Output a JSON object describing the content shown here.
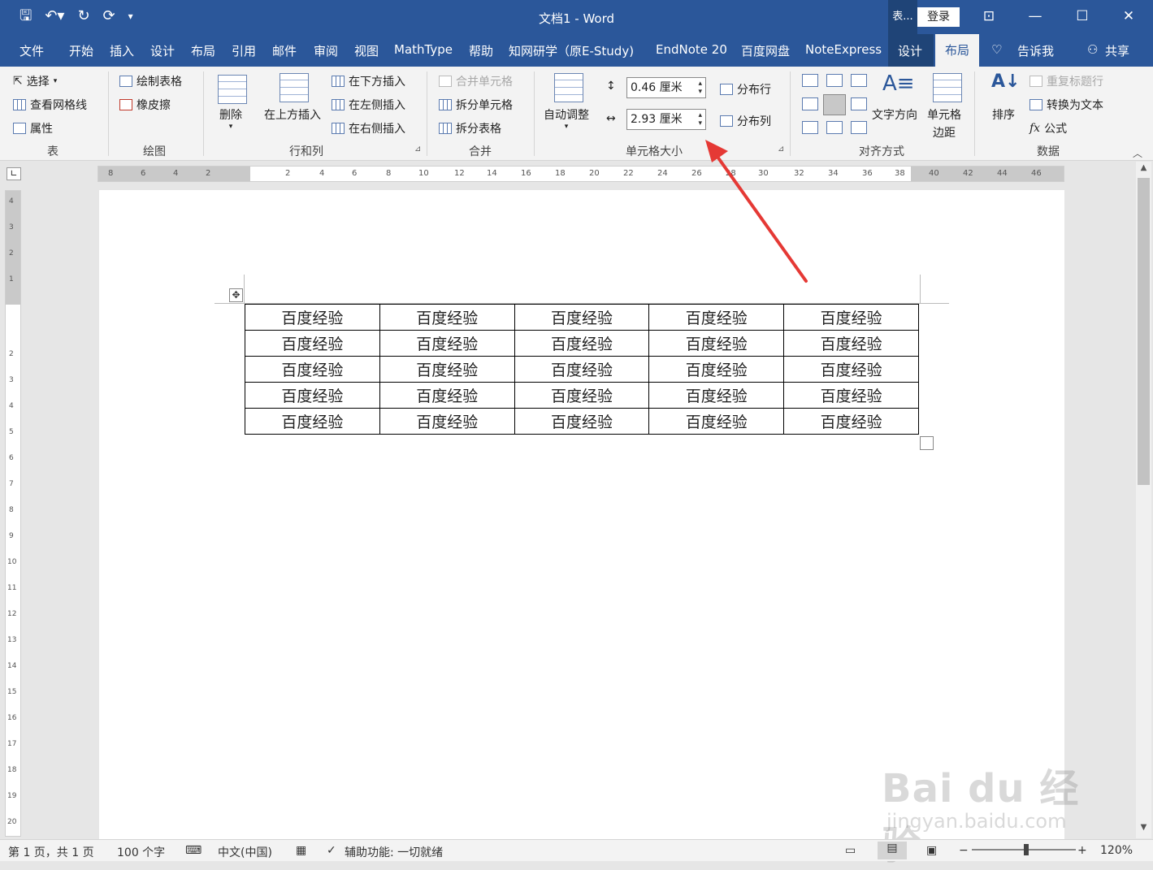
{
  "titlebar": {
    "doc_title": "文档1  -  Word",
    "context_label": "表...",
    "login": "登录"
  },
  "tabs": [
    "文件",
    "开始",
    "插入",
    "设计",
    "布局",
    "引用",
    "邮件",
    "审阅",
    "视图",
    "MathType",
    "帮助",
    "知网研学（原E-Study)",
    "EndNote 20",
    "百度网盘",
    "NoteExpress",
    "设计"
  ],
  "active_tab": "布局",
  "tell_me": "告诉我",
  "share": "共享",
  "ribbon": {
    "group_table": {
      "select": "选择",
      "gridlines": "查看网格线",
      "properties": "属性",
      "label": "表"
    },
    "group_draw": {
      "draw_table": "绘制表格",
      "eraser": "橡皮擦",
      "label": "绘图"
    },
    "group_rows": {
      "delete": "删除",
      "insert_above": "在上方插入",
      "insert_below": "在下方插入",
      "insert_left": "在左侧插入",
      "insert_right": "在右侧插入",
      "label": "行和列"
    },
    "group_merge": {
      "merge_cells": "合并单元格",
      "split_cells": "拆分单元格",
      "split_table": "拆分表格",
      "label": "合并"
    },
    "group_size": {
      "autofit": "自动调整",
      "height": "0.46 厘米",
      "width": "2.93 厘米",
      "distribute_rows": "分布行",
      "distribute_cols": "分布列",
      "label": "单元格大小"
    },
    "group_align": {
      "text_direction": "文字方向",
      "cell_margins_1": "单元格",
      "cell_margins_2": "边距",
      "label": "对齐方式"
    },
    "group_data": {
      "sort": "排序",
      "repeat_header": "重复标题行",
      "convert_text": "转换为文本",
      "formula": "公式",
      "label": "数据"
    }
  },
  "table": {
    "rows": [
      [
        "百度经验",
        "百度经验",
        "百度经验",
        "百度经验",
        "百度经验"
      ],
      [
        "百度经验",
        "百度经验",
        "百度经验",
        "百度经验",
        "百度经验"
      ],
      [
        "百度经验",
        "百度经验",
        "百度经验",
        "百度经验",
        "百度经验"
      ],
      [
        "百度经验",
        "百度经验",
        "百度经验",
        "百度经验",
        "百度经验"
      ],
      [
        "百度经验",
        "百度经验",
        "百度经验",
        "百度经验",
        "百度经验"
      ]
    ]
  },
  "statusbar": {
    "page": "第 1 页，共 1 页",
    "words": "100 个字",
    "language": "中文(中国)",
    "accessibility": "辅助功能: 一切就绪",
    "zoom": "120%"
  },
  "watermark": {
    "line1": "Bai du 经验",
    "line2": "jingyan.baidu.com"
  },
  "colors": {
    "accent": "#2b579a",
    "context_tab": "#1f4477",
    "arrow": "#e53935"
  }
}
